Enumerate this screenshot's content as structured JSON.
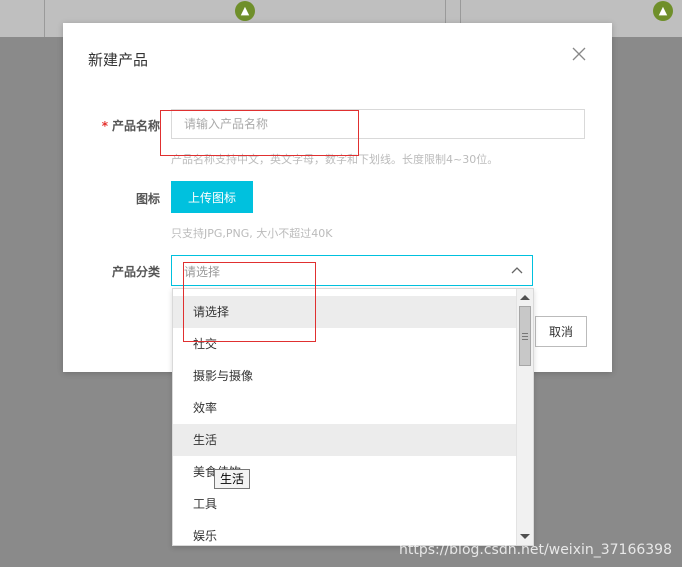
{
  "modal": {
    "title": "新建产品",
    "fields": {
      "name": {
        "required_mark": "*",
        "label": "产品名称",
        "placeholder": "请输入产品名称",
        "value": "",
        "hint": "产品名称支持中文，英文字母，数字和下划线。长度限制4~30位。"
      },
      "icon": {
        "label": "图标",
        "button_label": "上传图标",
        "hint": "只支持JPG,PNG, 大小不超过40K"
      },
      "category": {
        "label": "产品分类",
        "selected": "请选择",
        "expanded": true
      }
    },
    "cancel_label": "取消"
  },
  "dropdown": {
    "options": [
      {
        "label": "请选择",
        "highlighted": true
      },
      {
        "label": "社交",
        "highlighted": false
      },
      {
        "label": "摄影与摄像",
        "highlighted": false
      },
      {
        "label": "效率",
        "highlighted": false
      },
      {
        "label": "生活",
        "highlighted": true
      },
      {
        "label": "美食佳饮",
        "highlighted": false
      },
      {
        "label": "工具",
        "highlighted": false
      },
      {
        "label": "娱乐",
        "highlighted": false
      }
    ],
    "tooltip": "生活"
  },
  "colors": {
    "accent": "#00c1de",
    "required": "#e5322e",
    "annotation": "#e03030",
    "android": "#6f8f2a"
  },
  "icons": [
    "android-icon",
    "close-icon",
    "chevron-up-icon"
  ],
  "watermark": "https://blog.csdn.net/weixin_37166398"
}
